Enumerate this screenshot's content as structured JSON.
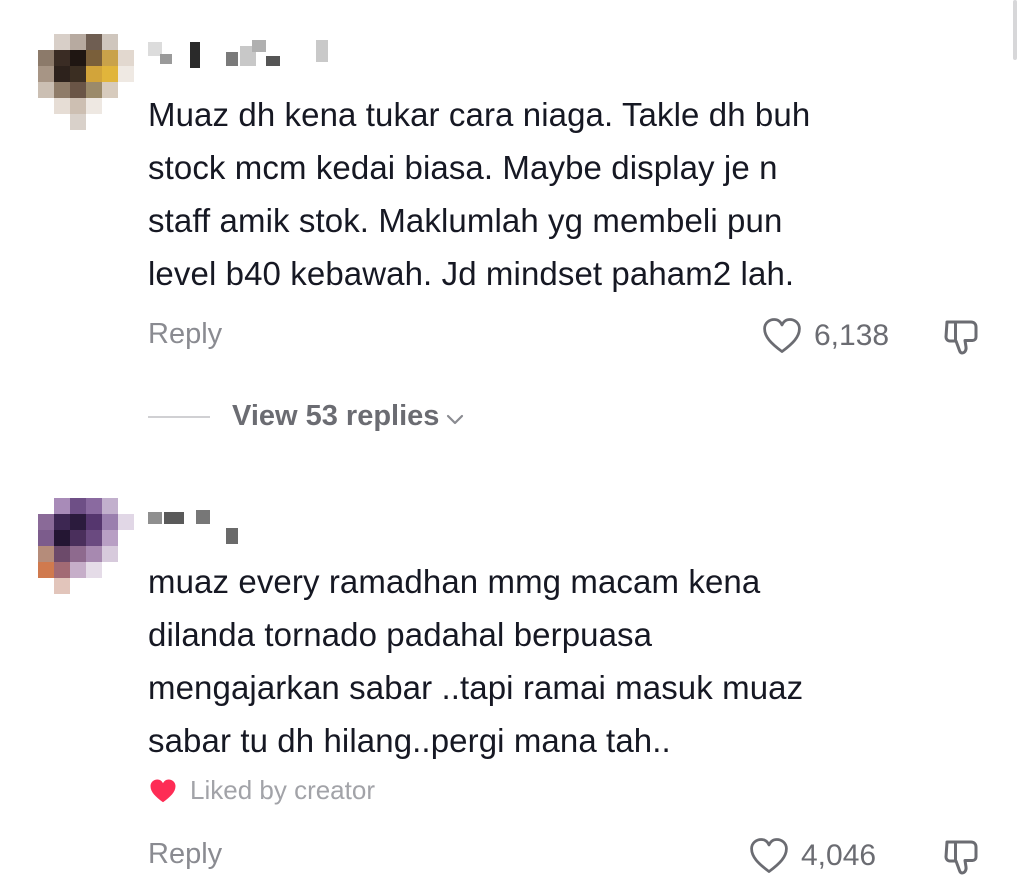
{
  "comments": [
    {
      "text": "Muaz dh kena tukar cara niaga. Takle dh buh\nstock mcm kedai biasa. Maybe display je n\nstaff amik stok. Maklumlah yg membeli pun\nlevel b40 kebawah. Jd mindset paham2 lah.",
      "reply_label": "Reply",
      "like_count": "6,138",
      "view_replies_label": "View 53 replies",
      "avatar": "pixelated-avatar",
      "username": "pixelated-username"
    },
    {
      "text": "muaz every ramadhan mmg macam kena\ndilanda tornado padahal berpuasa\nmengajarkan sabar ..tapi ramai masuk muaz\nsabar tu dh hilang..pergi mana tah..",
      "liked_by_label": "Liked by creator",
      "reply_label": "Reply",
      "like_count": "4,046",
      "avatar": "pixelated-avatar",
      "username": "pixelated-username"
    }
  ],
  "icons": {
    "like": "heart-outline-icon",
    "dislike": "thumbs-down-icon",
    "expand": "chevron-down-icon",
    "creator_like": "heart-filled-icon"
  },
  "colors": {
    "text": "#161823",
    "secondary": "#8a8b91",
    "muted": "#a2a3a8",
    "creator_heart": "#fe2c55"
  }
}
